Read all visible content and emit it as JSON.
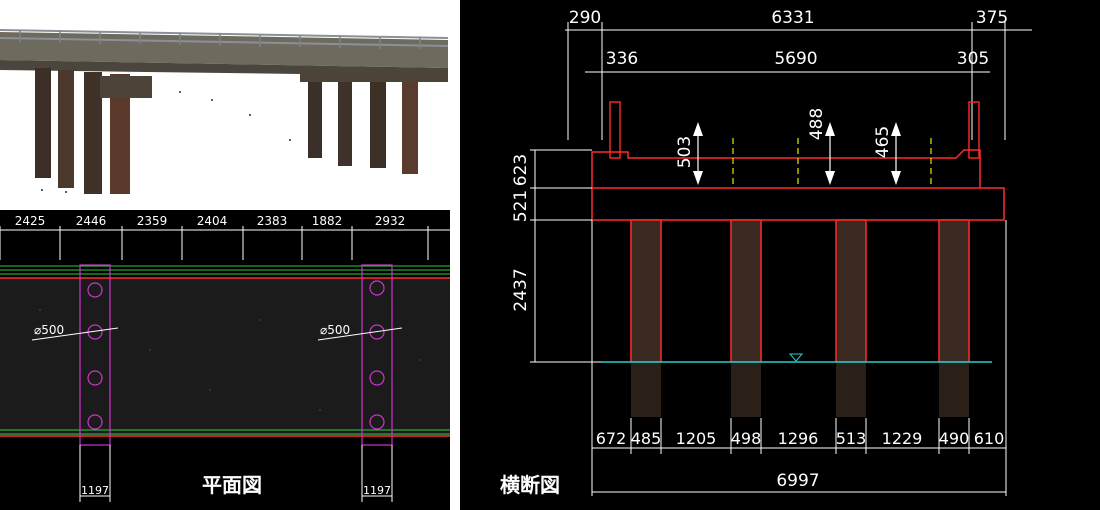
{
  "plan": {
    "title": "平面図",
    "top_dims": [
      "2425",
      "2446",
      "2359",
      "2404",
      "2383",
      "1882",
      "2932"
    ],
    "pile_dia": [
      "⌀500",
      "⌀500"
    ],
    "bottom_dims": [
      "1197",
      "1197"
    ]
  },
  "section": {
    "title": "横断図",
    "top_dims": [
      "290",
      "6331",
      "375"
    ],
    "second_dims": [
      "336",
      "5690",
      "305"
    ],
    "slope_vals": [
      "503",
      "488",
      "465"
    ],
    "left_dims": [
      "623",
      "521",
      "2437"
    ],
    "bottom_dims": [
      "672",
      "485",
      "1205",
      "498",
      "1296",
      "513",
      "1229",
      "490",
      "610"
    ],
    "total": "6997"
  },
  "colors": {
    "background": "#000000",
    "outline": "#ff2a2a",
    "plan_line": "#2ecc40",
    "pile_box": "#cc33cc",
    "water_line": "#20d0d0",
    "centerline": "#e8e800"
  }
}
